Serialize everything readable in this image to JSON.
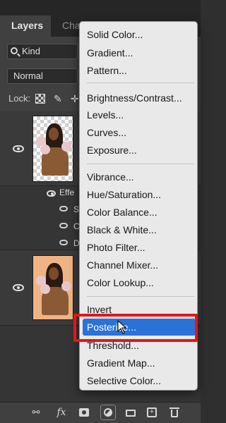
{
  "panel": {
    "tabs": [
      "Layers",
      "Chann"
    ],
    "filter_kind": "Kind",
    "blend_mode": "Normal",
    "lock_label": "Lock:",
    "effects_label": "Effe",
    "effect_items": [
      "S",
      "C",
      "D"
    ]
  },
  "menu": {
    "groups": [
      [
        "Solid Color...",
        "Gradient...",
        "Pattern..."
      ],
      [
        "Brightness/Contrast...",
        "Levels...",
        "Curves...",
        "Exposure..."
      ],
      [
        "Vibrance...",
        "Hue/Saturation...",
        "Color Balance...",
        "Black & White...",
        "Photo Filter...",
        "Channel Mixer...",
        "Color Lookup..."
      ],
      [
        "Invert",
        "Posterize...",
        "Threshold...",
        "Gradient Map...",
        "Selective Color..."
      ]
    ],
    "selected": "Posterize..."
  },
  "bottom_bar": {
    "fx_label": "fx"
  },
  "colors": {
    "highlight_blue": "#2a72d8",
    "annotation_red": "#e5141c",
    "panel_bg": "#404040",
    "menu_bg": "#e9e9e9"
  },
  "icons": [
    "search-icon",
    "eye-icon",
    "lock-transparent-icon",
    "brush-icon",
    "move-icon",
    "link-icon",
    "fx-icon",
    "mask-icon",
    "adjustment-layer-icon",
    "folder-icon",
    "new-layer-icon",
    "trash-icon",
    "cursor-icon"
  ]
}
